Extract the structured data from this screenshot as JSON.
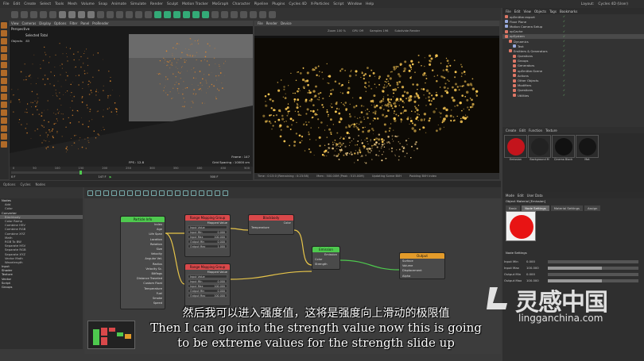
{
  "menubar": {
    "items": [
      "File",
      "Edit",
      "Create",
      "Select",
      "Tools",
      "Mesh",
      "Volume",
      "Snap",
      "Animate",
      "Simulate",
      "Render",
      "Sculpt",
      "Motion Tracker",
      "MoGraph",
      "Character",
      "Pipeline",
      "Plugins",
      "Cycles 4D",
      "X-Particles",
      "Script",
      "Window",
      "Help"
    ],
    "layout_label": "Layout:",
    "layout_value": "Cycles 4D (User)"
  },
  "viewport": {
    "menu": [
      "View",
      "Cameras",
      "Display",
      "Options",
      "Filter",
      "Panel",
      "ProRender"
    ],
    "name": "Perspective",
    "selected_total": "Selected Total",
    "objects_label": "Objects",
    "objects_value": "83",
    "frame": "Frame : 147",
    "grid_spacing": "Grid Spacing : 10000 cm",
    "fps": "FPS : 12.8"
  },
  "render_view": {
    "menu": [
      "File",
      "Render",
      "Device"
    ],
    "zoom_label": "Zoom",
    "zoom_value": "100 %",
    "gpu_label": "GPU",
    "gpu_value": "Off",
    "samples_label": "Samples",
    "samples_value": "196",
    "subdiv_label": "Subdivide",
    "subdiv_value": "Render",
    "status_time": "Time : 0:15:0 (Remaining : 0:23:58)",
    "status_mem": "Mem : 500.00M (Peak : 515.00M)",
    "status_update": "Updating Scene BVH",
    "status_engine": "Padding BVH Index"
  },
  "timeline": {
    "ticks": [
      "0",
      "50",
      "100",
      "150",
      "200",
      "250",
      "300",
      "350",
      "400",
      "450",
      "500"
    ],
    "start_frame": "0 F",
    "current_frame": "147 F",
    "end_frame": "500 F"
  },
  "xpresso_bar": {
    "label": "Options",
    "items": [
      "Cycles",
      "Nodes"
    ]
  },
  "node_list": {
    "title": "Nodes",
    "items": [
      {
        "label": "Add",
        "cat": false
      },
      {
        "label": "Color",
        "cat": false
      },
      {
        "label": "Converter",
        "cat": true
      },
      {
        "label": "Blackbody",
        "cat": false,
        "sel": true
      },
      {
        "label": "Color Ramp",
        "cat": false
      },
      {
        "label": "Combine HSV",
        "cat": false
      },
      {
        "label": "Combine RGB",
        "cat": false
      },
      {
        "label": "Combine XYZ",
        "cat": false
      },
      {
        "label": "Math",
        "cat": false
      },
      {
        "label": "RGB To BW",
        "cat": false
      },
      {
        "label": "Separate HSV",
        "cat": false
      },
      {
        "label": "Separate RGB",
        "cat": false
      },
      {
        "label": "Separate XYZ",
        "cat": false
      },
      {
        "label": "Vector Math",
        "cat": false
      },
      {
        "label": "Wavelength",
        "cat": false
      },
      {
        "label": "Input",
        "cat": true
      },
      {
        "label": "Shader",
        "cat": true
      },
      {
        "label": "Texture",
        "cat": true
      },
      {
        "label": "Vector",
        "cat": true
      },
      {
        "label": "Script",
        "cat": true
      },
      {
        "label": "Groups",
        "cat": true
      }
    ]
  },
  "nodes": {
    "particle_info": {
      "title": "Particle Info",
      "ports": [
        "Index",
        "Age",
        "Life Span",
        "Location",
        "Rotation",
        "Size",
        "Velocity",
        "Angular Vel.",
        "Radius",
        "Velocity Sc.",
        "Bitflags",
        "Distance Traveled",
        "Custom Float",
        "Temperature",
        "Fuel",
        "Smoke",
        "Speed"
      ]
    },
    "range_mapping_1": {
      "title": "Range Mapping Group",
      "mapped_value": "Mapped Value",
      "fields": [
        "Input Value",
        "Input Min",
        "Input Max",
        "Output Min",
        "Output Max"
      ],
      "values": [
        "",
        "0.000",
        "100.000",
        "0.000",
        "1.000"
      ]
    },
    "range_mapping_2": {
      "title": "Range Mapping Group",
      "mapped_value": "Mapped Value",
      "fields": [
        "Input Value",
        "Input Min",
        "Input Max",
        "Output Min",
        "Output Max"
      ],
      "values": [
        "",
        "0.000",
        "100.000",
        "0.000",
        "100.000"
      ]
    },
    "blackbody": {
      "title": "Blackbody",
      "out": "Color",
      "in": "Temperature"
    },
    "emission": {
      "title": "Emission",
      "out": "Emission",
      "in1": "Color",
      "in2": "Strength"
    },
    "output": {
      "title": "Output",
      "ports": [
        "Surface",
        "Volume",
        "Displacement",
        "Alpha"
      ]
    }
  },
  "object_manager": {
    "menu": [
      "File",
      "Edit",
      "View",
      "Objects",
      "Tags",
      "Bookmarks"
    ],
    "rows": [
      {
        "label": "xpEmitter.export",
        "indent": 0,
        "color": "#d76"
      },
      {
        "label": "Floor Plane",
        "indent": 0,
        "color": "#9ad"
      },
      {
        "label": "Motion Camera Setup",
        "indent": 0,
        "color": "#9ad"
      },
      {
        "label": "xpCache",
        "indent": 0,
        "color": "#d76"
      },
      {
        "label": "xpSystem",
        "indent": 0,
        "color": "#d76"
      },
      {
        "label": "Dynamics",
        "indent": 1,
        "color": "#d76"
      },
      {
        "label": "Text",
        "indent": 2,
        "color": "#9ad"
      },
      {
        "label": "Emitters & Generators",
        "indent": 1,
        "color": "#d76"
      },
      {
        "label": "Questions",
        "indent": 2,
        "color": "#d76"
      },
      {
        "label": "Groups",
        "indent": 2,
        "color": "#d76"
      },
      {
        "label": "Generators",
        "indent": 2,
        "color": "#d76"
      },
      {
        "label": "xpEmitter.Scene",
        "indent": 2,
        "color": "#d76"
      },
      {
        "label": "Actions",
        "indent": 2,
        "color": "#d76"
      },
      {
        "label": "Other Objects",
        "indent": 2,
        "color": "#d76"
      },
      {
        "label": "Modifiers",
        "indent": 2,
        "color": "#d76"
      },
      {
        "label": "Questions",
        "indent": 2,
        "color": "#d76"
      },
      {
        "label": "Utilities",
        "indent": 2,
        "color": "#d76"
      }
    ]
  },
  "materials": {
    "menu": [
      "Create",
      "Edit",
      "Function",
      "Texture"
    ],
    "items": [
      {
        "label": "Emission",
        "color": "#c4141c"
      },
      {
        "label": "Background M",
        "color": "#222"
      },
      {
        "label": "Cinema Black",
        "color": "#111"
      },
      {
        "label": "Mat",
        "color": "#151515"
      }
    ]
  },
  "attributes": {
    "menu": [
      "Mode",
      "Edit",
      "User Data"
    ],
    "object_label": "Object Material [Emission]",
    "tabs": [
      "Basic",
      "Node Settings",
      "Material Settings",
      "Assign"
    ],
    "active_tab": "Node Settings",
    "section": "Node Settings",
    "rows": [
      {
        "label": "Input Min",
        "value": "0.000",
        "fill": 0.0
      },
      {
        "label": "Input Max",
        "value": "100.000",
        "fill": 0.6
      },
      {
        "label": "Output Min",
        "value": "0.000",
        "fill": 0.0
      },
      {
        "label": "Output Max",
        "value": "100.000",
        "fill": 0.6
      }
    ]
  },
  "subtitles": {
    "zh": "然后我可以进入强度值，这将是强度向上滑动的极限值",
    "en_line1": "Then I can go into the strength value now this is going",
    "en_line2": "to be extreme values for the strength slide up"
  },
  "watermark": {
    "zh": "灵感中国",
    "en": "lingganchina.com"
  },
  "colors": {
    "particle_gold": "#ffcc55",
    "node_green": "#4ec94e",
    "node_red": "#d9484a",
    "node_orange": "#e39b2a",
    "wire_yellow": "#e6c44a"
  }
}
